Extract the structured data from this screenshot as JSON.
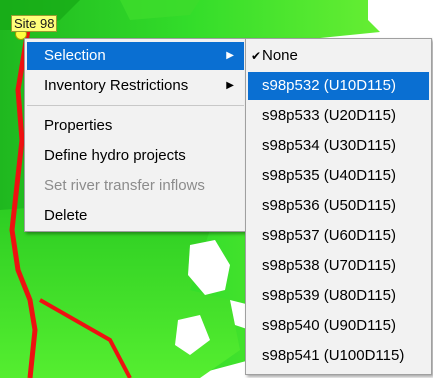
{
  "map": {
    "site_label": "Site 98"
  },
  "context_menu": {
    "items": [
      {
        "label": "Selection",
        "has_submenu": true,
        "highlighted": true
      },
      {
        "label": "Inventory Restrictions",
        "has_submenu": true
      },
      {
        "label": "Properties"
      },
      {
        "label": "Define hydro projects"
      },
      {
        "label": "Set river transfer inflows",
        "disabled": true
      },
      {
        "label": "Delete"
      }
    ],
    "submenu_arrow_icon": "arrow-right-icon"
  },
  "selection_submenu": {
    "items": [
      {
        "label": "None",
        "checked": true
      },
      {
        "label": "s98p532 (U10D115)",
        "highlighted": true
      },
      {
        "label": "s98p533 (U20D115)"
      },
      {
        "label": "s98p534 (U30D115)"
      },
      {
        "label": "s98p535 (U40D115)"
      },
      {
        "label": "s98p536 (U50D115)"
      },
      {
        "label": "s98p537 (U60D115)"
      },
      {
        "label": "s98p538 (U70D115)"
      },
      {
        "label": "s98p539 (U80D115)"
      },
      {
        "label": "s98p540 (U90D115)"
      },
      {
        "label": "s98p541 (U100D115)"
      }
    ],
    "check_icon": "checkmark-icon"
  },
  "colors": {
    "highlight": "#0a6fd2",
    "menu_bg": "#f2f2f2",
    "terrain_green": "#22cc22",
    "river_red": "#ee1111"
  }
}
